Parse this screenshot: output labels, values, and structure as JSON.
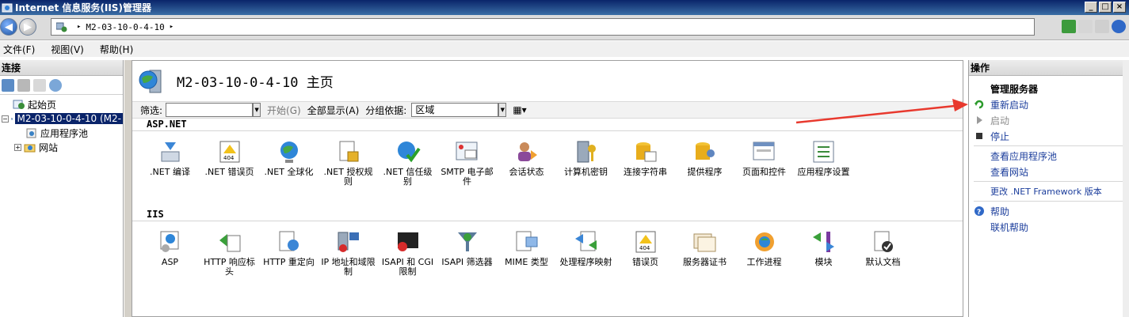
{
  "window": {
    "title": "Internet 信息服务(IIS)管理器",
    "min_glyph": "_",
    "max_glyph": "□",
    "close_glyph": "×"
  },
  "address": {
    "segments": [
      "M2-03-10-0-4-10"
    ],
    "sep_glyph": "▸"
  },
  "menu": [
    "文件(F)",
    "视图(V)",
    "帮助(H)"
  ],
  "left": {
    "header": "连接",
    "tree": [
      {
        "label": "起始页",
        "toggle": ""
      },
      {
        "label": "M2-03-10-0-4-10 (M2-",
        "toggle": "−"
      },
      {
        "label": "应用程序池",
        "toggle": ""
      },
      {
        "label": "网站",
        "toggle": "+"
      }
    ]
  },
  "center": {
    "title": "M2-03-10-0-4-10 主页",
    "filter": {
      "label": "筛选:",
      "start": "开始(G)",
      "show_all": "全部显示(A)",
      "group_by": "分组依据:",
      "group_value": "区域"
    },
    "sections": [
      {
        "title": "ASP.NET",
        "items": [
          ".NET 编译",
          ".NET 错误页",
          ".NET 全球化",
          ".NET 授权规则",
          ".NET 信任级别",
          "SMTP 电子邮件",
          "会话状态",
          "计算机密钥",
          "连接字符串",
          "提供程序",
          "页面和控件",
          "应用程序设置"
        ]
      },
      {
        "title": "IIS",
        "items": [
          "ASP",
          "HTTP 响应标头",
          "HTTP 重定向",
          "IP 地址和域限制",
          "ISAPI 和 CGI 限制",
          "ISAPI 筛选器",
          "MIME 类型",
          "处理程序映射",
          "错误页",
          "服务器证书",
          "工作进程",
          "模块",
          "默认文档"
        ]
      }
    ]
  },
  "right": {
    "header": "操作",
    "group_title": "管理服务器",
    "actions": {
      "restart": "重新启动",
      "start": "启动",
      "stop": "停止",
      "view_app_pools": "查看应用程序池",
      "view_sites": "查看网站",
      "change_framework": "更改 .NET Framework 版本",
      "help": "帮助",
      "online_help": "联机帮助"
    }
  },
  "colors": {
    "title_bar": "#0a246a",
    "link": "#1c3e9c",
    "arrow": "#e8392e"
  }
}
